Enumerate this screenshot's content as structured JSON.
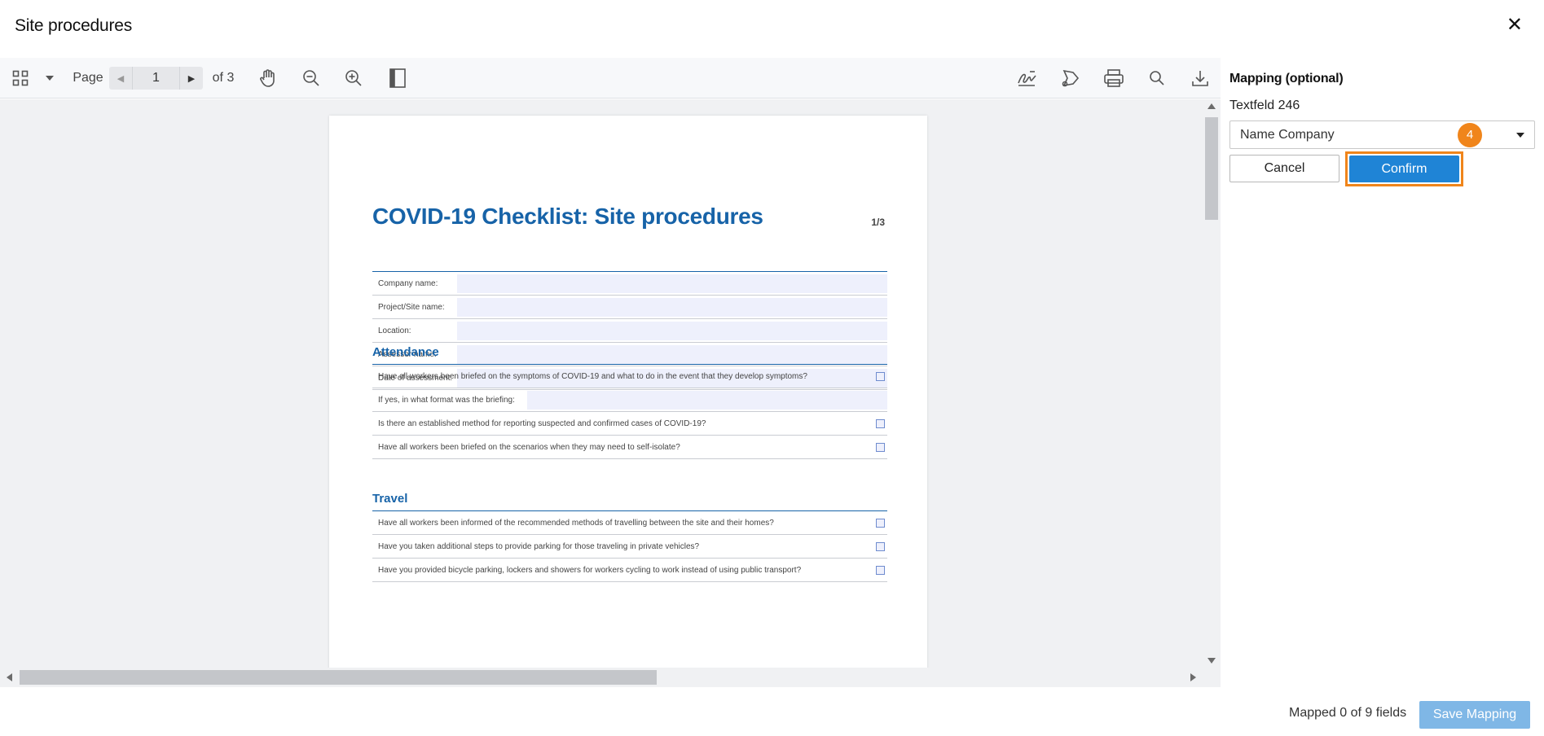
{
  "dialog": {
    "title": "Site procedures",
    "close_icon": "close-icon"
  },
  "toolbar": {
    "page_label": "Page",
    "current_page": "1",
    "of_label": "of 3",
    "icons_left": [
      "grid-view-icon",
      "chevron-down-icon",
      "hand-pan-icon",
      "zoom-out-icon",
      "zoom-in-icon",
      "single-page-icon"
    ],
    "icons_right": [
      "signature-icon",
      "annotate-icon",
      "print-icon",
      "search-icon",
      "download-icon"
    ]
  },
  "document": {
    "title": "COVID-19 Checklist: Site procedures",
    "page_indicator": "1/3",
    "form_fields": [
      "Company name:",
      "Project/Site name:",
      "Location:",
      "Assessor name:",
      "Date of assessment:"
    ],
    "sections": [
      {
        "heading": "Attendance",
        "rows": [
          {
            "text": "Have all workers been briefed on the symptoms of COVID-19 and what to do in the event that they develop symptoms?",
            "type": "checkbox"
          },
          {
            "text": "If yes, in what format was the briefing:",
            "type": "text"
          },
          {
            "text": "Is there an established method for reporting suspected and confirmed cases of COVID-19?",
            "type": "checkbox"
          },
          {
            "text": "Have all workers been briefed on the scenarios when they may need to self-isolate?",
            "type": "checkbox"
          }
        ]
      },
      {
        "heading": "Travel",
        "rows": [
          {
            "text": "Have all workers been informed of the recommended methods of travelling between the site and their homes?",
            "type": "checkbox"
          },
          {
            "text": "Have you taken additional steps to provide parking for those traveling in private vehicles?",
            "type": "checkbox"
          },
          {
            "text": "Have you provided bicycle parking, lockers and showers for workers cycling to work instead of using public transport?",
            "type": "checkbox"
          }
        ]
      }
    ]
  },
  "mapping": {
    "title": "Mapping (optional)",
    "field_name": "Textfeld 246",
    "selected_value": "Name Company",
    "step_badge": "4",
    "cancel_label": "Cancel",
    "confirm_label": "Confirm"
  },
  "footer": {
    "status": "Mapped 0 of 9 fields",
    "save_label": "Save Mapping"
  },
  "colors": {
    "accent": "#1f84d6",
    "highlight": "#f0851b",
    "doc_blue": "#1763a8"
  }
}
